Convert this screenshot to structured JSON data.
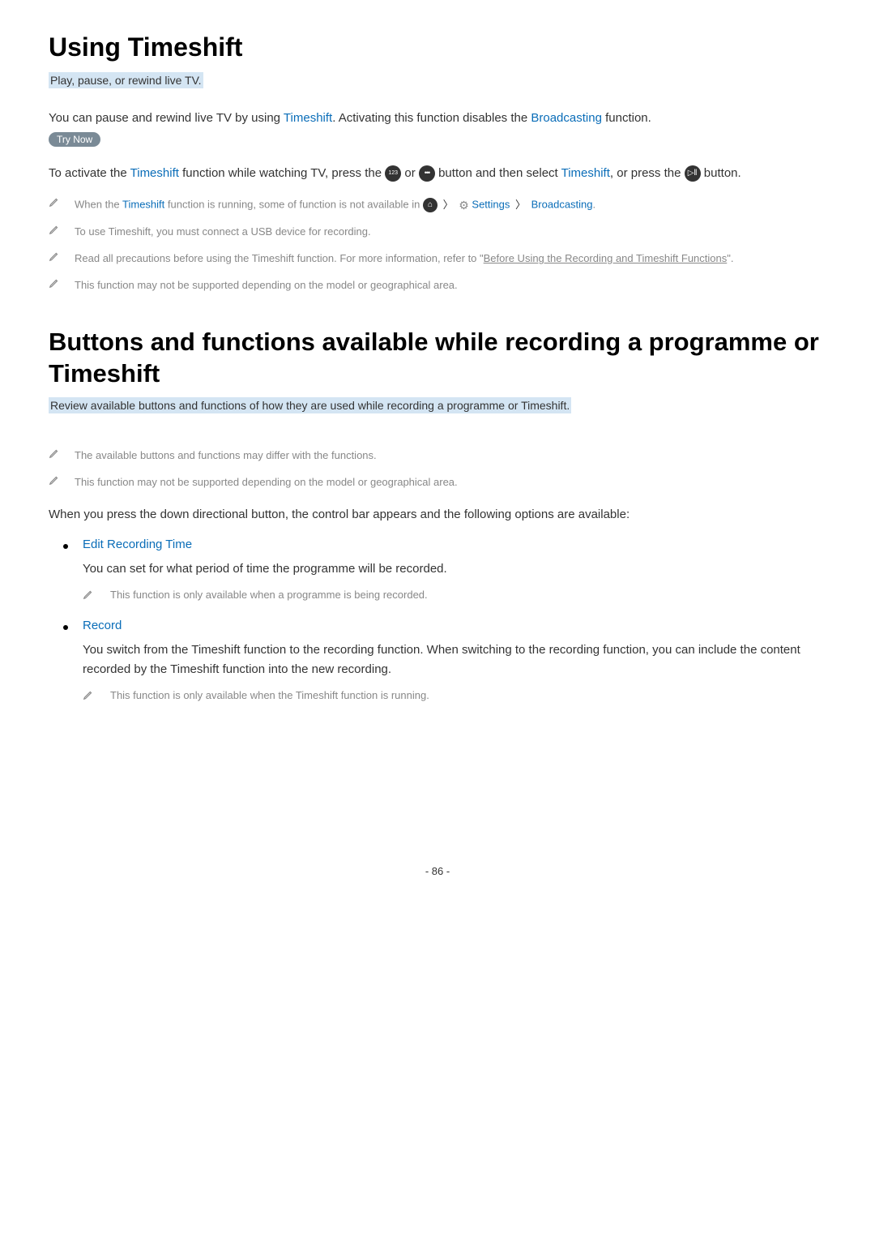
{
  "section1": {
    "heading": "Using Timeshift",
    "subtitle": "Play, pause, or rewind live TV.",
    "para1_a": "You can pause and rewind live TV by using ",
    "para1_b": "Timeshift",
    "para1_c": ". Activating this function disables the ",
    "para1_d": "Broadcasting",
    "para1_e": " function. ",
    "try_now": "Try Now",
    "para2_a": "To activate the ",
    "para2_b": "Timeshift",
    "para2_c": " function while watching TV, press the ",
    "para2_d": " or ",
    "para2_e": " button and then select ",
    "para2_f": "Timeshift",
    "para2_g": ", or press the ",
    "para2_h": " button.",
    "notes": [
      {
        "a": "When the ",
        "b": "Timeshift",
        "c": " function is running, some of function is not available in ",
        "settings": " Settings ",
        "broadcasting": " Broadcasting",
        "end": "."
      },
      {
        "text": "To use Timeshift, you must connect a USB device for recording."
      },
      {
        "a": "Read all precautions before using the Timeshift function. For more information, refer to \"",
        "link": "Before Using the Recording and Timeshift Functions",
        "b": "\"."
      },
      {
        "text": "This function may not be supported depending on the model or geographical area."
      }
    ]
  },
  "section2": {
    "heading": "Buttons and functions available while recording a programme or Timeshift",
    "subtitle": "Review available buttons and functions of how they are used while recording a programme or Timeshift.",
    "notes": [
      {
        "text": "The available buttons and functions may differ with the functions."
      },
      {
        "text": "This function may not be supported depending on the model or geographical area."
      }
    ],
    "intro": "When you press the down directional button, the control bar appears and the following options are available:",
    "items": [
      {
        "title": "Edit Recording Time",
        "body": "You can set for what period of time the programme will be recorded.",
        "note": "This function is only available when a programme is being recorded."
      },
      {
        "title": "Record",
        "body": "You switch from the Timeshift function to the recording function. When switching to the recording function, you can include the content recorded by the Timeshift function into the new recording.",
        "note": "This function is only available when the Timeshift function is running."
      }
    ]
  },
  "page": "- 86 -"
}
